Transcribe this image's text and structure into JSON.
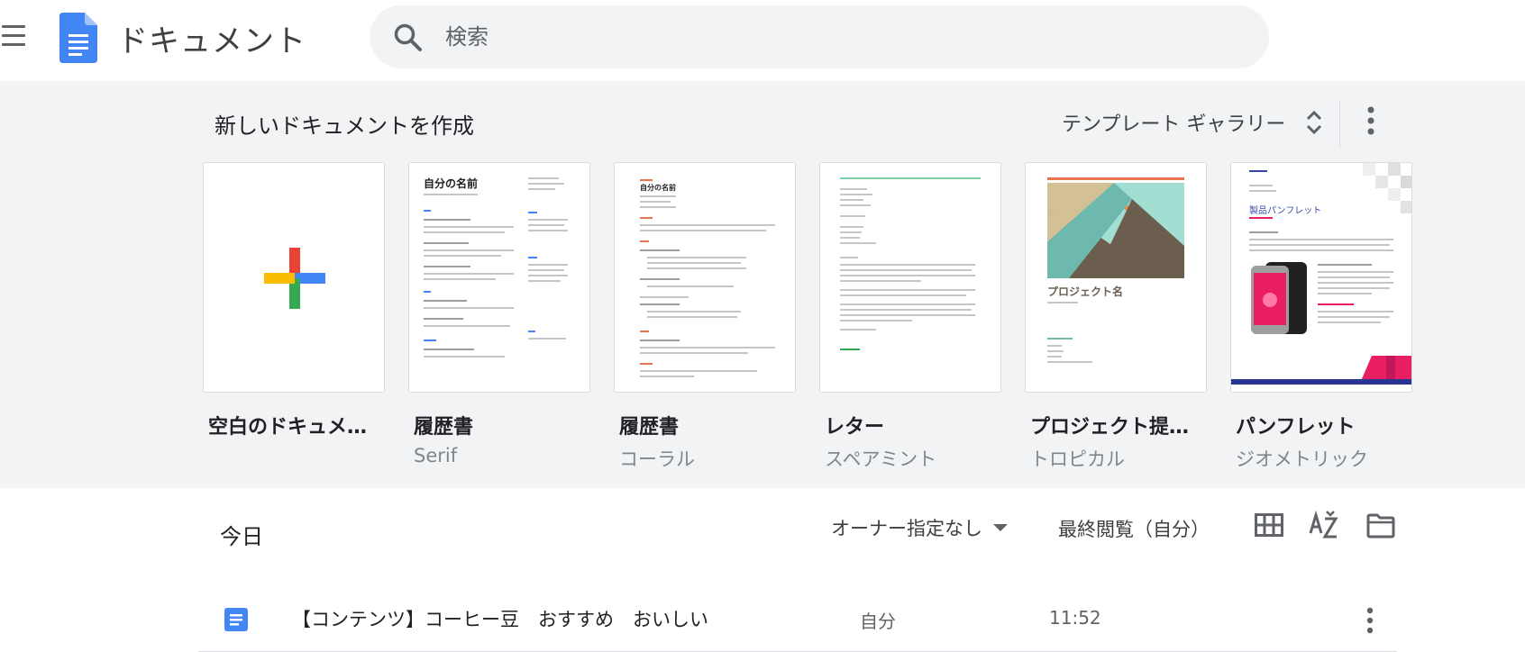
{
  "app": {
    "title": "ドキュメント"
  },
  "search": {
    "placeholder": "検索"
  },
  "templates": {
    "heading": "新しいドキュメントを作成",
    "gallery_label": "テンプレート ギャラリー",
    "items": [
      {
        "name": "空白のドキュメン…",
        "subtitle": ""
      },
      {
        "name": "履歴書",
        "subtitle": "Serif",
        "thumb_title": "自分の名前"
      },
      {
        "name": "履歴書",
        "subtitle": "コーラル",
        "thumb_title": "自分の名前"
      },
      {
        "name": "レター",
        "subtitle": "スペアミント"
      },
      {
        "name": "プロジェクト提案…",
        "subtitle": "トロピカル",
        "thumb_title": "プロジェクト名"
      },
      {
        "name": "パンフレット",
        "subtitle": "ジオメトリック",
        "thumb_title": "製品パンフレット"
      }
    ]
  },
  "recent": {
    "heading": "今日",
    "owner_filter": "オーナー指定なし",
    "sort_label": "最終閲覧（自分）",
    "files": [
      {
        "name": "【コンテンツ】コーヒー豆　おすすめ　おいしい",
        "owner": "自分",
        "time": "11:52"
      }
    ]
  },
  "colors": {
    "docs_blue": "#4285f4",
    "coral": "#e8744f",
    "mint": "#7bcfa9",
    "brochure_accent": "#e91e63"
  }
}
